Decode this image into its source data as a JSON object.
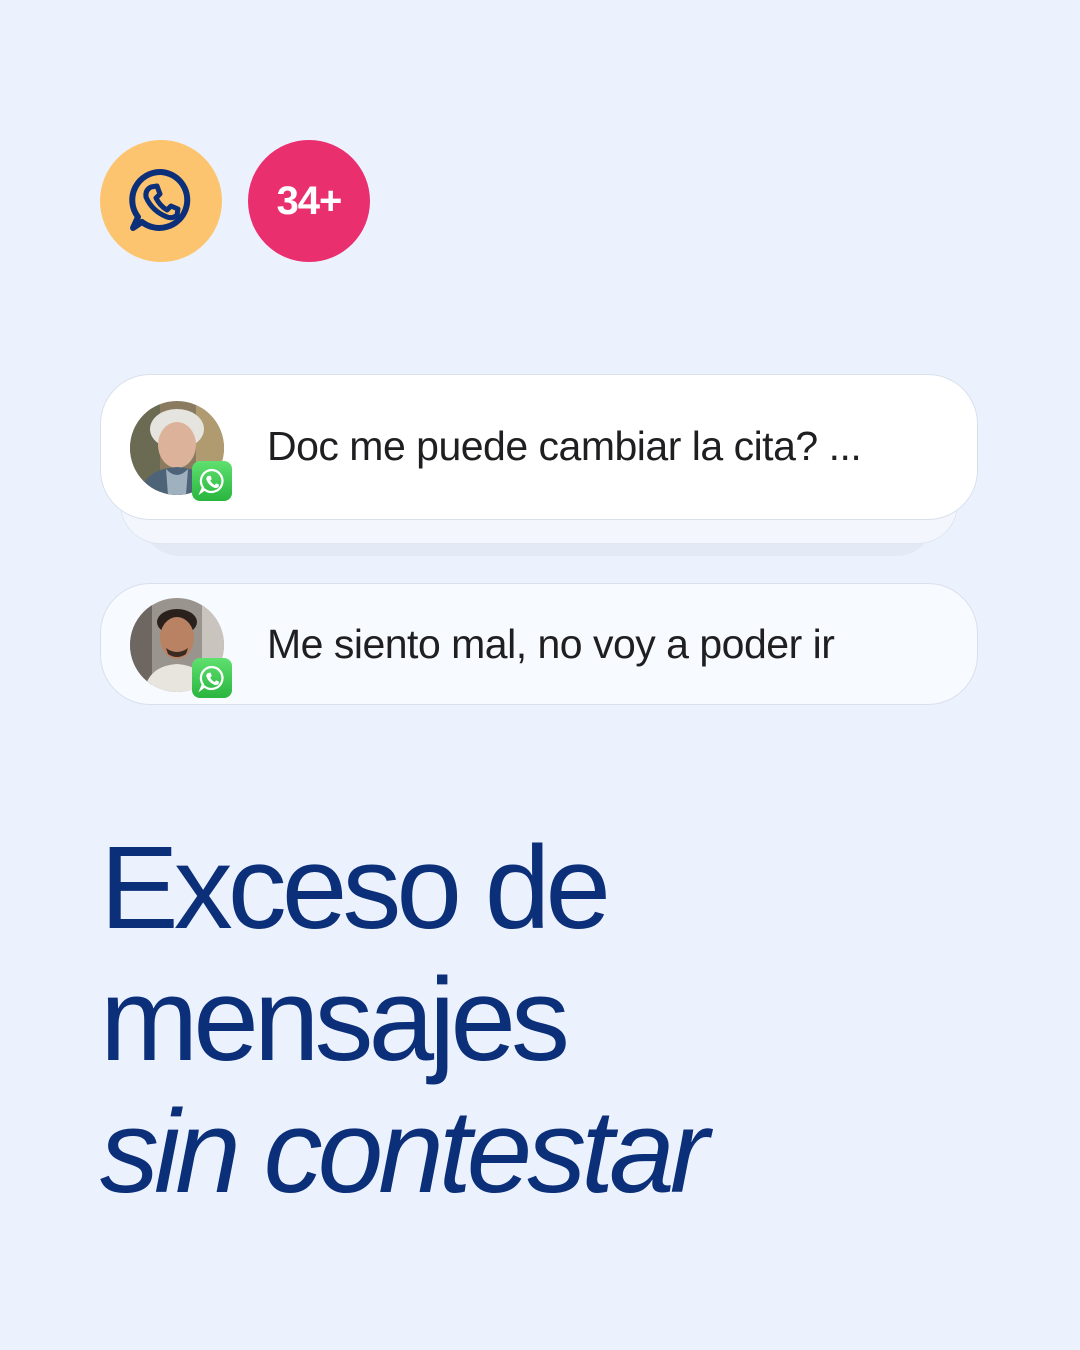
{
  "header": {
    "app_icon": "whatsapp-icon",
    "unread_count": "34+"
  },
  "messages": [
    {
      "text": "Doc me puede cambiar la cita? ...",
      "avatar": "elderly-woman-avatar",
      "channel_icon": "whatsapp-icon"
    },
    {
      "text": "Me siento mal, no voy a poder ir",
      "avatar": "young-man-avatar",
      "channel_icon": "whatsapp-icon"
    }
  ],
  "headline": {
    "line1": "Exceso de",
    "line2": "mensajes",
    "line3": "sin contestar"
  },
  "colors": {
    "background": "#ecf2fd",
    "whatsapp_circle": "#fcc46e",
    "count_badge": "#ea2f6f",
    "headline": "#0b2f78",
    "whatsapp_green": "#29b53f"
  }
}
